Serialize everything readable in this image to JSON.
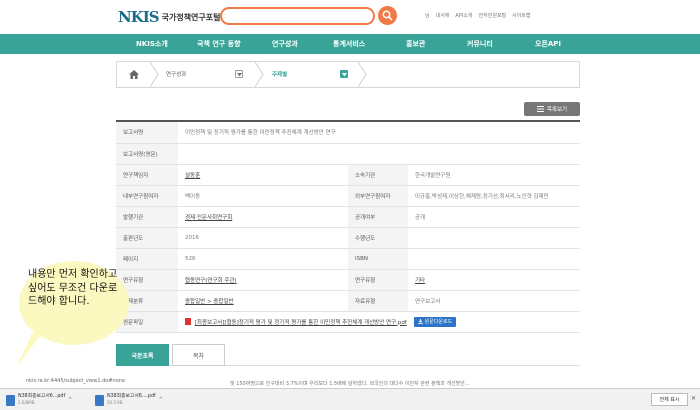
{
  "header": {
    "logo_mark": "NKIS",
    "logo_text": "국가정책연구포털",
    "search_placeholder": "",
    "util_links": [
      "님",
      "내서재",
      "API소개",
      "전자민원포털",
      "사이트맵"
    ]
  },
  "nav": {
    "items": [
      "NKIS소개",
      "국책 연구 동향",
      "연구성과",
      "통계서비스",
      "홍보관",
      "커뮤니티",
      "오픈API"
    ]
  },
  "breadcrumb": {
    "level1": "연구성과",
    "level2": "주제별"
  },
  "list_button": "목록보기",
  "table": {
    "rows": [
      {
        "label": "보고서명",
        "value": "이민정책 및 정기적 평가를 통한 이민정책 추진체계 개선방안 연구",
        "span": true
      },
      {
        "label": "보고서명(영문)",
        "value": "",
        "span": true
      },
      {
        "label": "연구책임자",
        "value": "설동훈",
        "link": true,
        "label2": "소속기관",
        "value2": "한국개발연구원"
      },
      {
        "label": "내부연구참여자",
        "value": "백이동",
        "label2": "외부연구참여자",
        "value2": "이규홍,박성제,이상헌,채재원,정기선,최서리,노인혁 김재민"
      },
      {
        "label": "발행기관",
        "value": "경제·인문사회연구회",
        "link": true,
        "label2": "공개여부",
        "value2": "공개"
      },
      {
        "label": "출판년도",
        "value": "2016",
        "label2": "수행년도",
        "value2": ""
      },
      {
        "label": "페이지",
        "value": "526",
        "label2": "ISBN",
        "value2": ""
      },
      {
        "label": "연구유형",
        "value": "협동연구(연구회 주관)",
        "link": true,
        "label2": "연구유형",
        "value2": "기타",
        "link2": true
      },
      {
        "label": "주제분류",
        "value": "종합일반 > 종합일반",
        "link": true,
        "label2": "자료유형",
        "value2": "연구보고서"
      },
      {
        "label": "원문파일",
        "value": "[최종보고서][협동]정기적 평가 및 정기적 평가를 통한 이민정책 추진체계 개선방안 연구.pdf",
        "link": true,
        "span": true
      }
    ],
    "download_button": "원문다운로드"
  },
  "tabs": [
    "국문초록",
    "목차"
  ],
  "status_url": "nkis.re.kr:4445/subject_view1.do#none",
  "abstract_snippet": "및 150여명으로 인구대비 3.7%이며 우리보다 1.5배에 달하였다. 외국인의 대다수 이민자 관련 정책과 개선방안...",
  "bubble_text": "내용만 먼저 확인하고 싶어도 무조건 다운로드해야 합니다.",
  "downloads": [
    {
      "name": "N38최종보고서6...pdf",
      "size": "2.6/8MB"
    },
    {
      "name": "N38최종보고서6....pdf",
      "size": "50.5 KB"
    }
  ],
  "download_bar": {
    "show_all": "전체 표시",
    "close": "✕"
  },
  "colors": {
    "teal": "#3aa397",
    "orange": "#f07a45",
    "bubble": "#fbf8c0"
  }
}
